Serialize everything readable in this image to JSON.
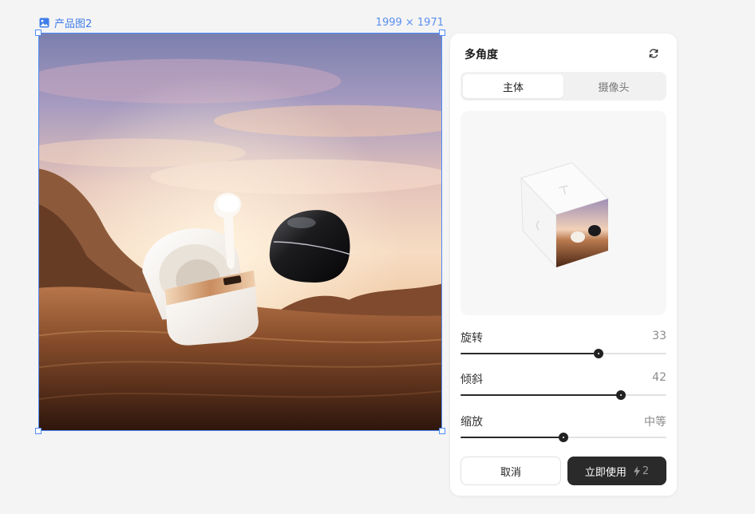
{
  "canvas": {
    "frame_name": "产品图2",
    "frame_size": "1999 × 1971"
  },
  "panel": {
    "title": "多角度",
    "tabs": [
      {
        "label": "主体",
        "active": true
      },
      {
        "label": "摄像头",
        "active": false
      }
    ],
    "sliders": [
      {
        "label": "旋转",
        "value": "33",
        "level": 0.67
      },
      {
        "label": "倾斜",
        "value": "42",
        "level": 0.78
      },
      {
        "label": "缩放",
        "value": "中等",
        "level": 0.5
      }
    ],
    "cancel_label": "取消",
    "apply_label": "立即使用",
    "cost": "2"
  },
  "colors": {
    "accent": "#4f8cf7",
    "primary_button": "#2a2a2a"
  },
  "icons": {
    "frame": "image-icon",
    "refresh": "refresh-icon",
    "cost": "lightning-icon"
  }
}
